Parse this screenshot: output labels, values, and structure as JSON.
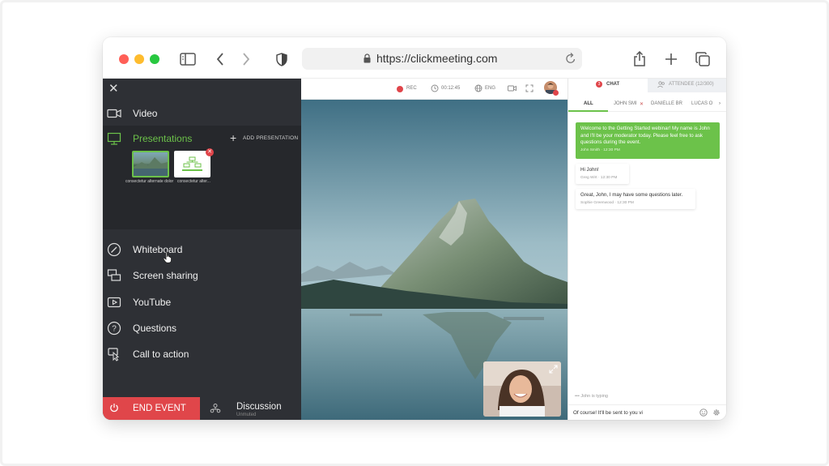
{
  "browser": {
    "url": "https://clickmeeting.com"
  },
  "sidebar": {
    "items": [
      {
        "label": "Video",
        "icon": "video-camera-icon"
      },
      {
        "label": "Presentations",
        "icon": "presentation-icon"
      },
      {
        "label": "Whiteboard",
        "icon": "pen-icon"
      },
      {
        "label": "Screen sharing",
        "icon": "screen-share-icon"
      },
      {
        "label": "YouTube",
        "icon": "play-icon"
      },
      {
        "label": "Questions",
        "icon": "question-icon"
      },
      {
        "label": "Call to action",
        "icon": "cursor-icon"
      }
    ],
    "add_presentation": "ADD PRESENTATION",
    "thumbnails": [
      {
        "caption": "consectetur alternate dolor"
      },
      {
        "caption": "consectetur alter..."
      }
    ],
    "end_event": "END EVENT",
    "discussion": "Discussion",
    "discussion_sub": "Unmuted"
  },
  "stage": {
    "rec": "REC",
    "timer": "00:12:45",
    "language": "ENG"
  },
  "chat": {
    "tab_chat": "CHAT",
    "tab_chat_badge": "3",
    "tab_attendees": "ATTENDEE (12/300)",
    "subtabs": [
      "ALL",
      "JOHN SMI",
      "DANIELLE BR",
      "LUCAS O"
    ],
    "messages": [
      {
        "text": "Welcome to the Getting Started webinar! My name is John and I'll be your moderator today. Please feel free to ask questions during the event.",
        "author": "John Smith",
        "time": "12:30 PM"
      },
      {
        "text": "Hi John!",
        "author": "Greg Wirt",
        "time": "12:30 PM"
      },
      {
        "text": "Great, John, I may have some questions later.",
        "author": "Sophie Greenwood",
        "time": "12:30 PM"
      }
    ],
    "typing": "John is typing",
    "input_value": "Of course! It'll be sent to you vi"
  },
  "colors": {
    "accent_green": "#6cc24a",
    "end_red": "#e0464a",
    "panel_dark": "#2e3035"
  }
}
